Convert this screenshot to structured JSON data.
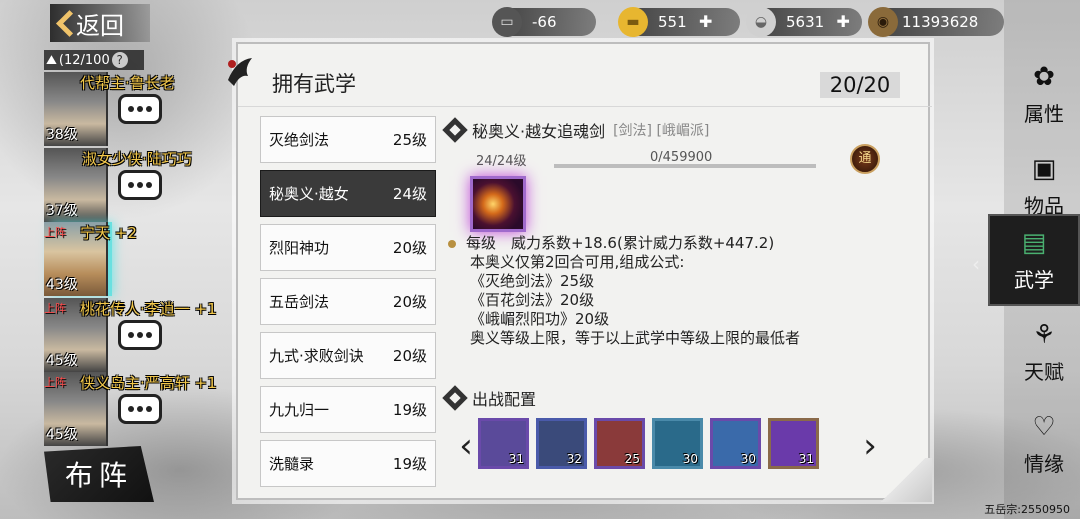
{
  "back": {
    "label": "返回"
  },
  "resources": [
    {
      "icon": "cart-icon",
      "value": "-66",
      "color": "#9a9a9a",
      "has_plus": false
    },
    {
      "icon": "gold-ingot-icon",
      "value": "551",
      "color": "#e7b630",
      "has_plus": true
    },
    {
      "icon": "silver-ingot-icon",
      "value": "5631",
      "color": "#d0d0d0",
      "has_plus": true
    },
    {
      "icon": "coin-icon",
      "value": "11393628",
      "color": "#8a6a3a",
      "has_plus": false
    }
  ],
  "team": {
    "count": "(12/100",
    "help": "?",
    "members": [
      {
        "tag": "",
        "name": "代帮主·鲁长老",
        "level": "38级"
      },
      {
        "tag": "",
        "name": "淑女少侠·陆巧巧",
        "level": "37级"
      },
      {
        "tag": "上阵",
        "name": "宁天 +2",
        "level": "43级"
      },
      {
        "tag": "上阵",
        "name": "桃花传人·李逍一 +1",
        "level": "45级"
      },
      {
        "tag": "上阵",
        "name": "侠义岛主·严高轩 +1",
        "level": "45级"
      }
    ],
    "formation_label": "布阵"
  },
  "panel": {
    "title": "拥有武学",
    "count": "20/20",
    "skills": [
      {
        "name": "灭绝剑法",
        "level": "25级"
      },
      {
        "name": "秘奥义·越女",
        "level": "24级"
      },
      {
        "name": "烈阳神功",
        "level": "20级"
      },
      {
        "name": "五岳剑法",
        "level": "20级"
      },
      {
        "name": "九式·求败剑诀",
        "level": "20级"
      },
      {
        "name": "九九归一",
        "level": "19级"
      },
      {
        "name": "洗髓录",
        "level": "19级"
      }
    ],
    "detail": {
      "name": "秘奥义·越女追魂剑",
      "tags": "[剑法] [峨嵋派]",
      "level_label": "24/24级",
      "xp": "0/459900",
      "xp_fraction": 0,
      "tong": "通",
      "effect_title": "每级　威力系数+18.6(累计威力系数+447.2)",
      "lines": [
        "本奥义仅第2回合可用,组成公式:",
        "《灭绝剑法》25级",
        "《百花剑法》20级",
        "《峨嵋烈阳功》20级",
        "奥义等级上限，等于以上武学中等级上限的最低者"
      ]
    },
    "loadout": {
      "title": "出战配置",
      "slots": [
        {
          "level": "31",
          "color": "#6a4aaa",
          "bg": "#5a4a9a"
        },
        {
          "level": "32",
          "color": "#4a5aaa",
          "bg": "#3a4a7a"
        },
        {
          "level": "25",
          "color": "#6a4aaa",
          "bg": "#8a3a3a"
        },
        {
          "level": "30",
          "color": "#4a8aaa",
          "bg": "#2a6a8a"
        },
        {
          "level": "30",
          "color": "#6a4aaa",
          "bg": "#3a6aaa"
        },
        {
          "level": "31",
          "color": "#8a6a4a",
          "bg": "#6a3aaa"
        }
      ]
    }
  },
  "nav": [
    {
      "label": "属性",
      "icon": "seal-icon"
    },
    {
      "label": "物品",
      "icon": "box-icon"
    },
    {
      "label": "武学",
      "icon": "book-icon"
    },
    {
      "label": "天赋",
      "icon": "branch-icon"
    },
    {
      "label": "情缘",
      "icon": "heart-icon"
    }
  ],
  "footer": "五岳宗:2550950"
}
